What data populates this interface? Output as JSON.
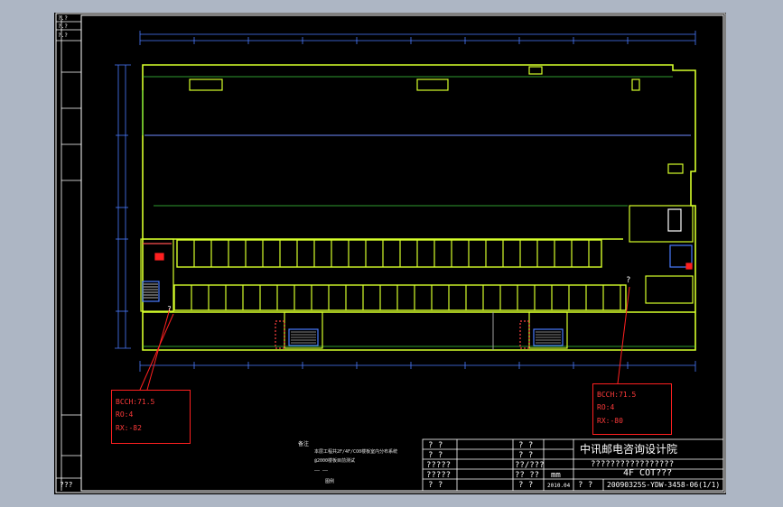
{
  "sheet": {
    "left_strip_label": "???",
    "left_strip_top_marks": [
      "?.?",
      "?.?",
      "?.?"
    ]
  },
  "callouts": [
    {
      "line1": "BCCH:71.5",
      "line2": "RO:4",
      "line3": "RX:-82"
    },
    {
      "line1": "BCCH:71.5",
      "line2": "RO:4",
      "line3": "RX:-80"
    }
  ],
  "marker": "?",
  "notes": {
    "title": "备注",
    "line1": "本层工程共2F/4F/CO0楼板室内分布系统",
    "line2": "@2000楼板目前测试",
    "line3": "—— ——",
    "line4": "图例"
  },
  "title_block": {
    "company": "中讯邮电咨询设计院",
    "project": "?????????????????",
    "drawing_title": "4F COT???",
    "drawing_number": "20090325S-YDW-3458-06(1/1)",
    "date": "2010.04",
    "scale": "mm",
    "left_cells": [
      "? ?",
      "? ?",
      "?????",
      "?????",
      "? ?"
    ],
    "mid_cells": [
      "? ?",
      "? ?",
      "??/???",
      "??_??",
      "? ?"
    ],
    "bottom_mid": "? ?"
  }
}
